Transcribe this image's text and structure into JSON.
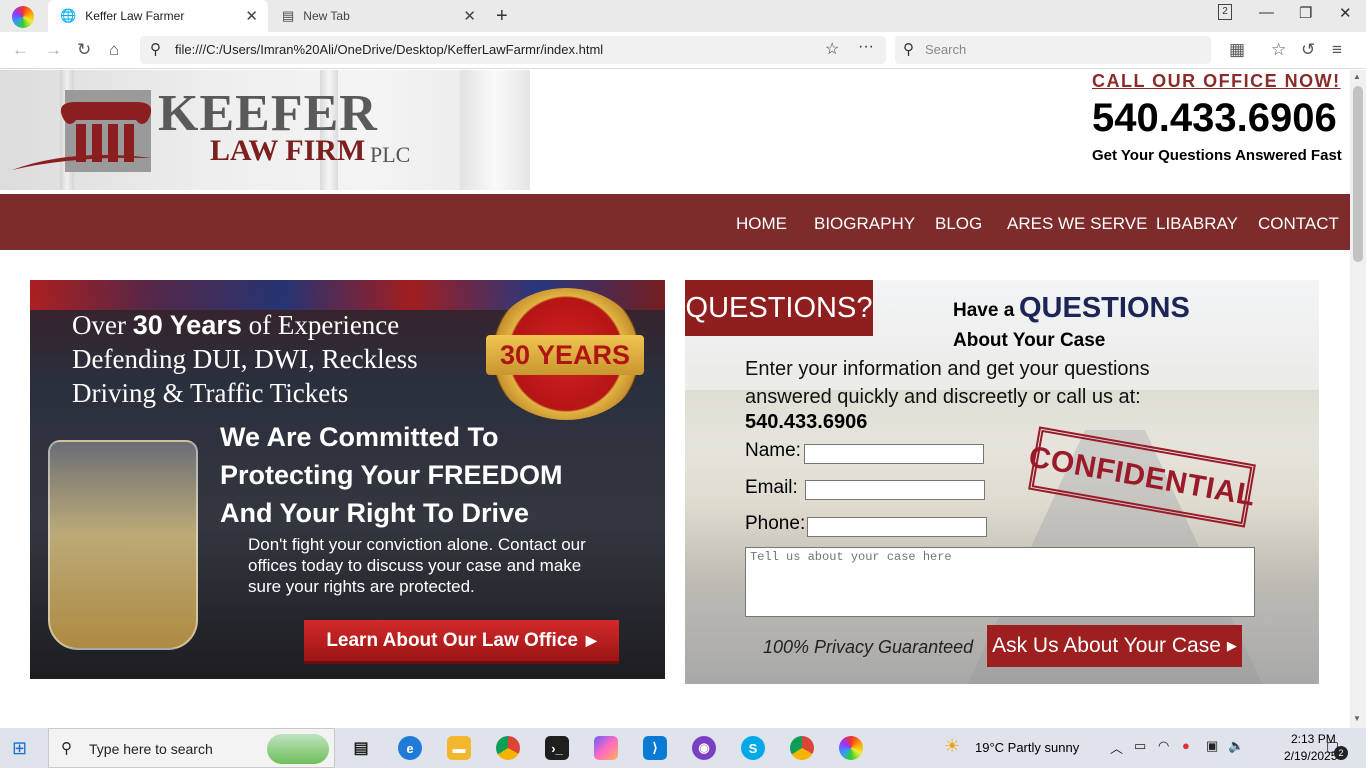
{
  "browser": {
    "tabs": [
      {
        "title": "Keffer Law Farmer",
        "active": true
      },
      {
        "title": "New Tab",
        "active": false
      }
    ],
    "new_tab_symbol": "+",
    "tab_count": "2",
    "url": "file:///C:/Users/Imran%20Ali/OneDrive/Desktop/KefferLawFarmr/index.html",
    "search_placeholder": "Search"
  },
  "header": {
    "brand_main": "KEEFER",
    "brand_sub": "LAW FIRM",
    "brand_suffix": "PLC",
    "call_label": "CALL OUR OFFICE NOW!",
    "phone": "540.433.6906",
    "tagline": "Get Your Questions Answered Fast"
  },
  "nav": {
    "items": [
      "HOME",
      "BIOGRAPHY",
      "BLOG",
      "ARES WE SERVE",
      "LIBABRAY",
      "CONTACT"
    ]
  },
  "banner": {
    "line1_pre": "Over ",
    "line1_bold": "30 Years",
    "line1_post": " of Experience",
    "line2": "Defending DUI, DWI, Reckless",
    "line3": "Driving & Traffic Tickets",
    "badge": "30 YEARS",
    "commit1": "We Are Committed To",
    "commit2": "Protecting Your FREEDOM",
    "commit3": "And Your Right To Drive",
    "body": "Don't fight your conviction alone.  Contact our offices today to discuss your case and make sure your rights are protected.",
    "button": "Learn About Our Law Office"
  },
  "form": {
    "questions_tag": "QUESTIONS?",
    "heading_have": "Have a",
    "heading_questions": "QUESTIONS",
    "heading_about": "About Your Case",
    "intro": "Enter your information and get your questions answered quickly and discreetly or call us at:",
    "phone": "540.433.6906",
    "name_label": "Name:",
    "email_label": "Email:",
    "phone_label": "Phone:",
    "case_placeholder": "Tell us about your case here",
    "stamp": "CONFIDENTIAL",
    "privacy": "100% Privacy Guaranteed",
    "submit": "Ask Us About Your Case"
  },
  "taskbar": {
    "search_placeholder": "Type here to search",
    "weather": "19°C  Partly sunny",
    "time": "2:13 PM",
    "date": "2/19/2025",
    "notifications": "2"
  }
}
